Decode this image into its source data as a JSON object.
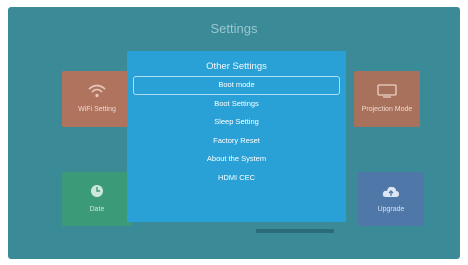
{
  "screen": {
    "title": "Settings"
  },
  "tiles": {
    "wifi": {
      "label": "WiFi Setting",
      "icon": "wifi-icon"
    },
    "projection": {
      "label": "Projection Mode",
      "icon": "projector-icon"
    },
    "date": {
      "label": "Date",
      "icon": "clock-icon"
    },
    "upgrade": {
      "label": "Upgrade",
      "icon": "cloud-upload-icon"
    }
  },
  "dialog": {
    "title": "Other Settings",
    "items": [
      {
        "label": "Boot mode",
        "selected": true
      },
      {
        "label": "Boot Settings"
      },
      {
        "label": "Sleep Setting"
      },
      {
        "label": "Factory Reset"
      },
      {
        "label": "About the System"
      },
      {
        "label": "HDMI CEC"
      }
    ]
  },
  "colors": {
    "background": "#3a8a98",
    "dialog": "#2aa1d6",
    "wifi_tile": "#b0735e",
    "projection_tile": "#a8715b",
    "date_tile": "#3b9b78",
    "upgrade_tile": "#4f77a8"
  }
}
